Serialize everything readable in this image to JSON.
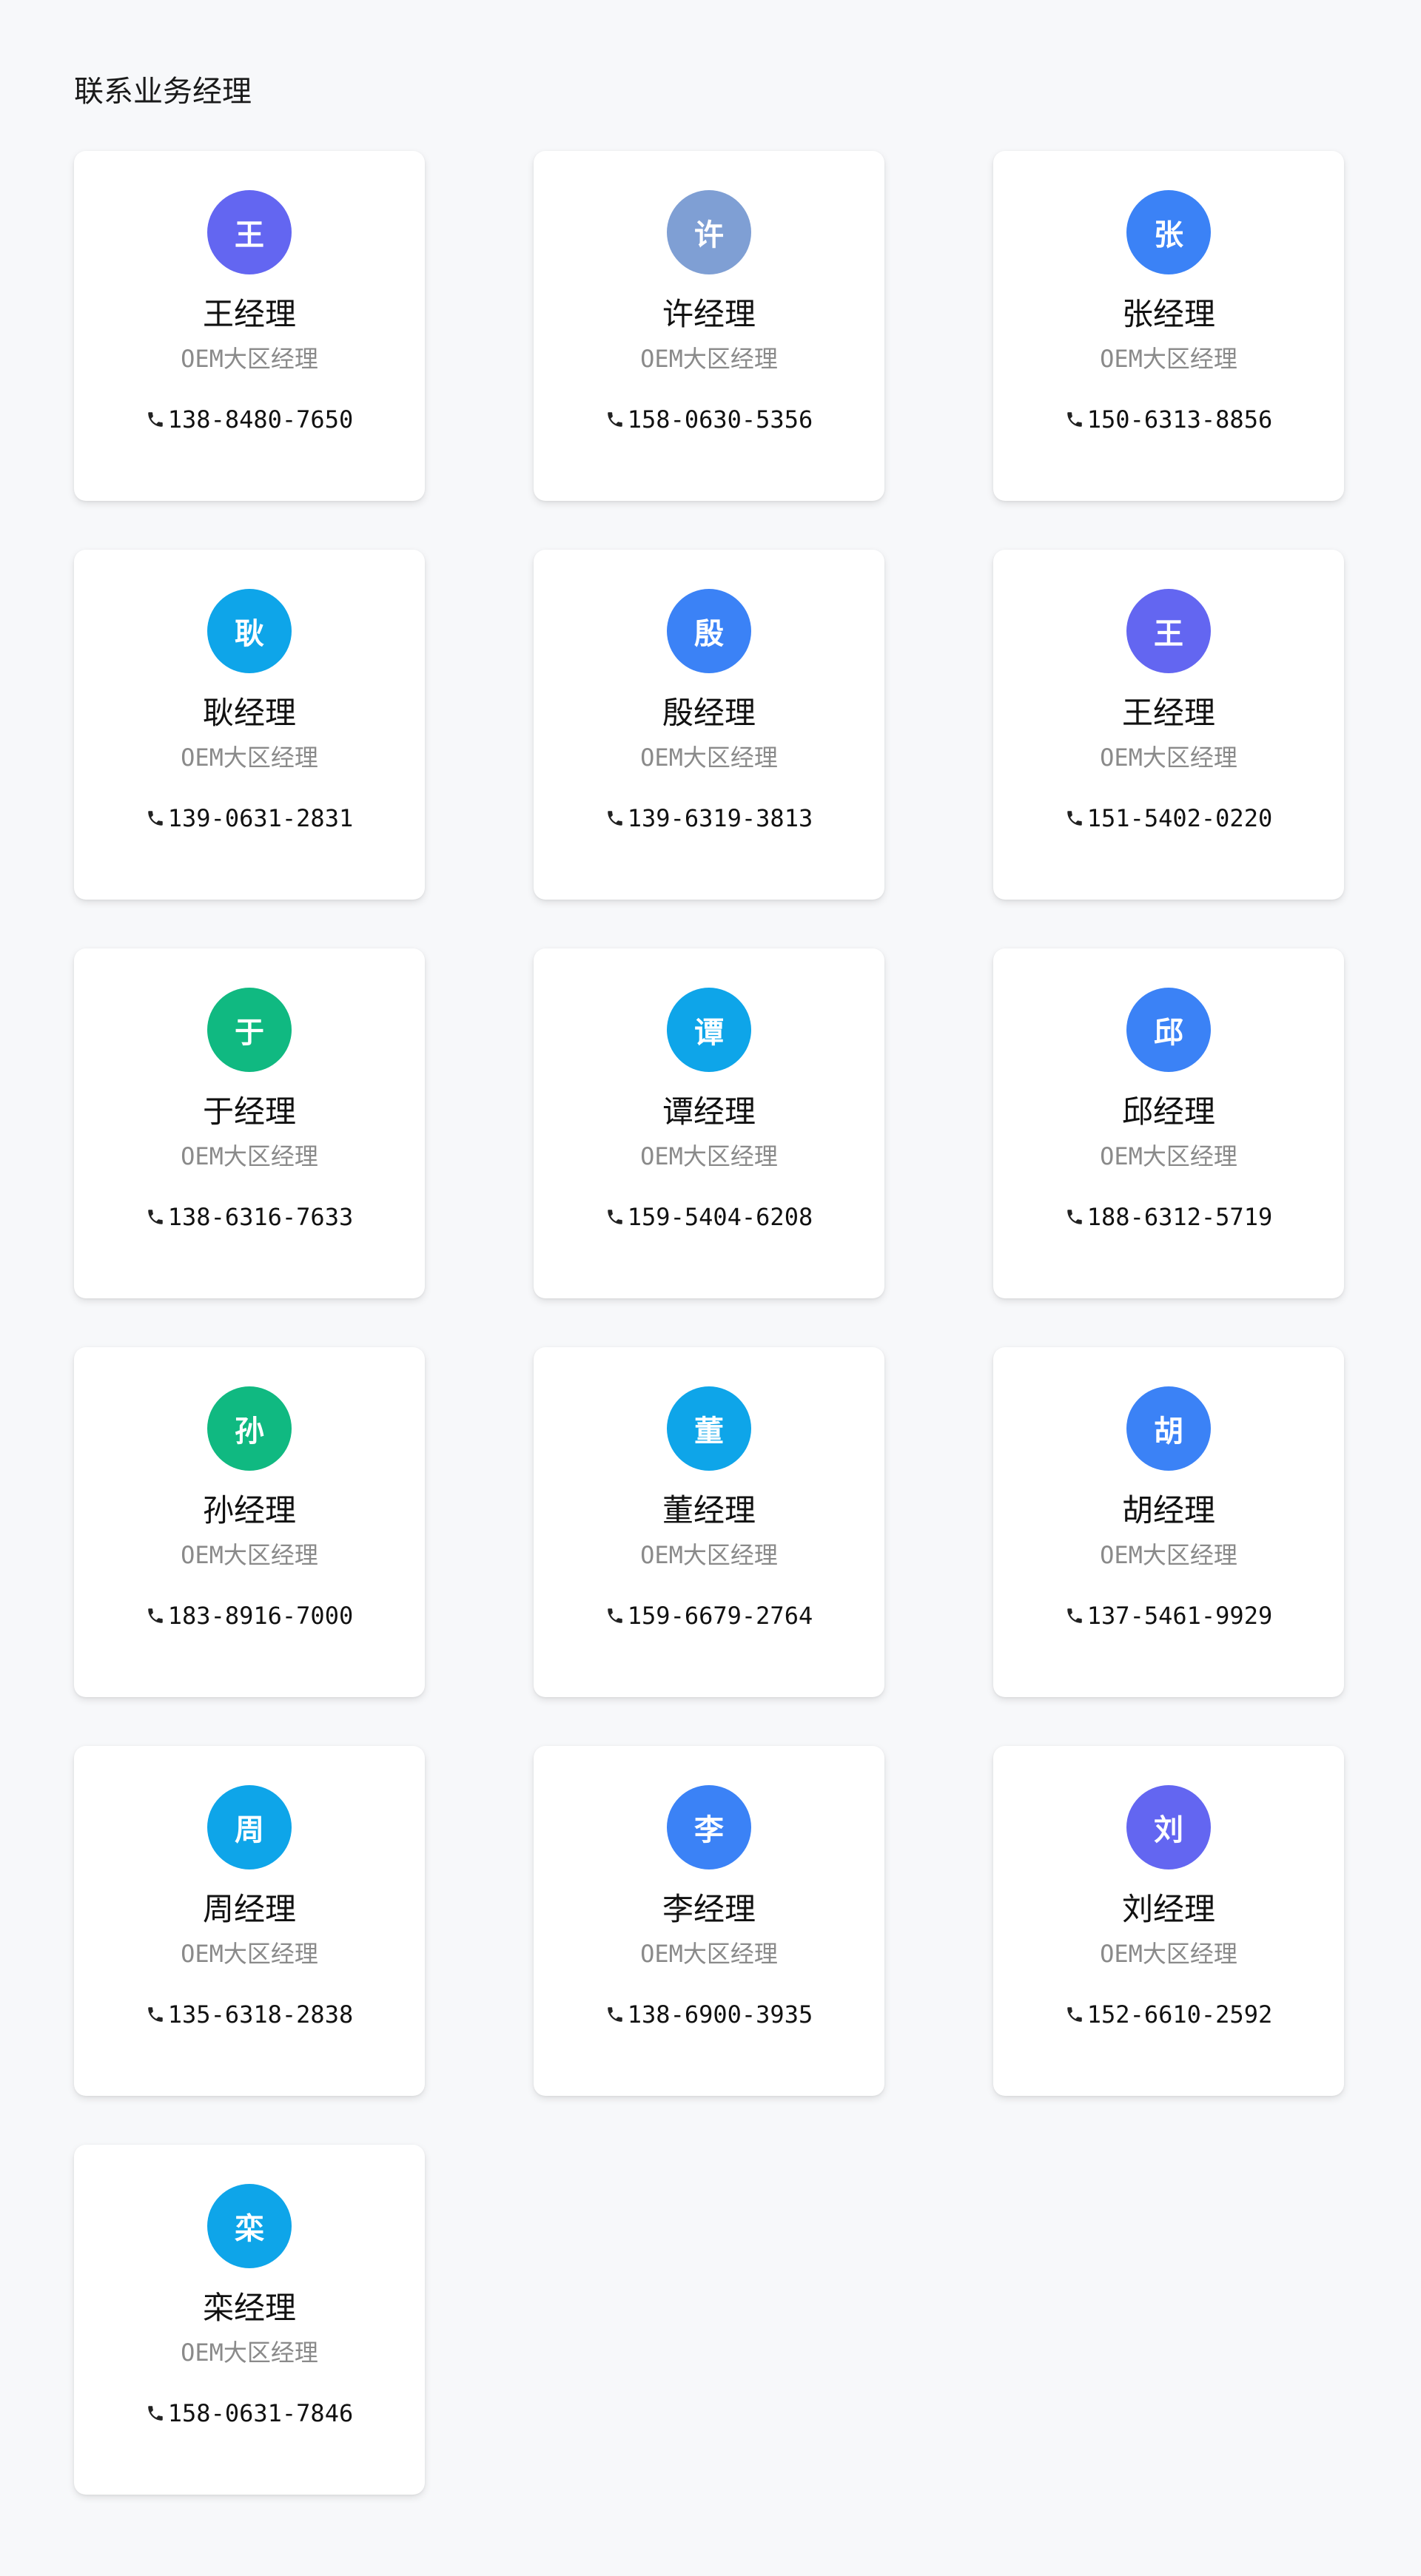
{
  "page": {
    "title": "联系业务经理"
  },
  "managers": [
    {
      "avatar_char": "王",
      "name": "王经理",
      "role": "OEM大区经理",
      "phone": "138-8480-7650",
      "avatar_color": "#6366f1"
    },
    {
      "avatar_char": "许",
      "name": "许经理",
      "role": "OEM大区经理",
      "phone": "158-0630-5356",
      "avatar_color": "#7f9fd4"
    },
    {
      "avatar_char": "张",
      "name": "张经理",
      "role": "OEM大区经理",
      "phone": "150-6313-8856",
      "avatar_color": "#3b82f6"
    },
    {
      "avatar_char": "耿",
      "name": "耿经理",
      "role": "OEM大区经理",
      "phone": "139-0631-2831",
      "avatar_color": "#0ea5e9"
    },
    {
      "avatar_char": "殷",
      "name": "殷经理",
      "role": "OEM大区经理",
      "phone": "139-6319-3813",
      "avatar_color": "#3b82f6"
    },
    {
      "avatar_char": "王",
      "name": "王经理",
      "role": "OEM大区经理",
      "phone": "151-5402-0220",
      "avatar_color": "#6366f1"
    },
    {
      "avatar_char": "于",
      "name": "于经理",
      "role": "OEM大区经理",
      "phone": "138-6316-7633",
      "avatar_color": "#10b981"
    },
    {
      "avatar_char": "谭",
      "name": "谭经理",
      "role": "OEM大区经理",
      "phone": "159-5404-6208",
      "avatar_color": "#0ea5e9"
    },
    {
      "avatar_char": "邱",
      "name": "邱经理",
      "role": "OEM大区经理",
      "phone": "188-6312-5719",
      "avatar_color": "#3b82f6"
    },
    {
      "avatar_char": "孙",
      "name": "孙经理",
      "role": "OEM大区经理",
      "phone": "183-8916-7000",
      "avatar_color": "#10b981"
    },
    {
      "avatar_char": "董",
      "name": "董经理",
      "role": "OEM大区经理",
      "phone": "159-6679-2764",
      "avatar_color": "#0ea5e9"
    },
    {
      "avatar_char": "胡",
      "name": "胡经理",
      "role": "OEM大区经理",
      "phone": "137-5461-9929",
      "avatar_color": "#3b82f6"
    },
    {
      "avatar_char": "周",
      "name": "周经理",
      "role": "OEM大区经理",
      "phone": "135-6318-2838",
      "avatar_color": "#0ea5e9"
    },
    {
      "avatar_char": "李",
      "name": "李经理",
      "role": "OEM大区经理",
      "phone": "138-6900-3935",
      "avatar_color": "#3b82f6"
    },
    {
      "avatar_char": "刘",
      "name": "刘经理",
      "role": "OEM大区经理",
      "phone": "152-6610-2592",
      "avatar_color": "#6366f1"
    },
    {
      "avatar_char": "栾",
      "name": "栾经理",
      "role": "OEM大区经理",
      "phone": "158-0631-7846",
      "avatar_color": "#0ea5e9"
    }
  ],
  "icons": {
    "phone": "phone-icon"
  }
}
